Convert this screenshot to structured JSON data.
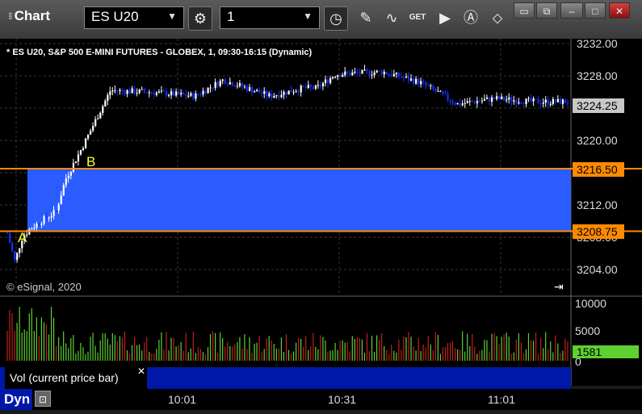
{
  "app": {
    "title": "Chart"
  },
  "toolbar": {
    "symbol": "ES U20",
    "interval": "1",
    "cursor_label": "GET"
  },
  "chart": {
    "header": "* ES U20, S&P 500 E-MINI FUTURES - GLOBEX, 1, 09:30-16:15 (Dynamic)",
    "copyright": "© eSignal, 2020",
    "price_axis": [
      "3232.00",
      "3228.00",
      "3220.00",
      "3212.00",
      "3208.00",
      "3204.00"
    ],
    "last_price": "3224.25",
    "level_high": "3216.50",
    "level_low": "3208.75",
    "marker_a": "A",
    "marker_b": "B",
    "time_axis": [
      "10:01",
      "10:31",
      "11:01"
    ],
    "volume_axis": [
      "10000",
      "5000",
      "0"
    ],
    "last_volume": "1581",
    "colors": {
      "box": "#2a5cff",
      "level": "#ff8a00",
      "up": "#ffffff",
      "down": "#1530ff",
      "vol_up": "#5fd032",
      "vol_down": "#c0201a",
      "marker": "#ffff33"
    }
  },
  "study": {
    "label": "Vol (current price bar)"
  },
  "status": {
    "mode": "Dyn"
  }
}
